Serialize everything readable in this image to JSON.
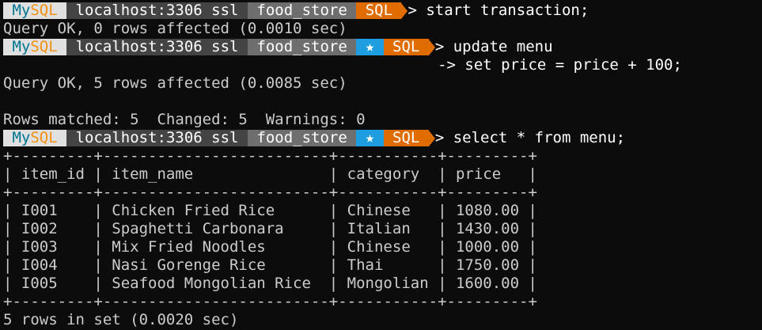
{
  "prompt": {
    "brand_my": "My",
    "brand_sql": "SQL",
    "host": "localhost:3306 ssl",
    "database": "food_store",
    "star": "★",
    "mode": "SQL",
    "arrow": "> ",
    "colors": {
      "mysql_bg": "#e0e0e0",
      "my_fg": "#00758f",
      "sql_fg": "#f29111",
      "host_bg": "#444444",
      "db_bg": "#6e6e6e",
      "star_bg": "#1e9ee0",
      "mode_bg": "#e06c00"
    }
  },
  "commands": {
    "c1": "start transaction;",
    "c2a": "update menu",
    "c2b": "                                                -> set price = price + 100;",
    "c3": "select * from menu;"
  },
  "outputs": {
    "o1": "Query OK, 0 rows affected (0.0010 sec)",
    "o2": "Query OK, 5 rows affected (0.0085 sec)",
    "o3": "Rows matched: 5  Changed: 5  Warnings: 0",
    "o4": "5 rows in set (0.0020 sec)"
  },
  "table": {
    "border": "+---------+-------------------------+-----------+---------+",
    "header": "| item_id | item_name               | category  | price   |",
    "rows": [
      "| I001    | Chicken Fried Rice      | Chinese   | 1080.00 |",
      "| I002    | Spaghetti Carbonara     | Italian   | 1430.00 |",
      "| I003    | Mix Fried Noodles       | Chinese   | 1000.00 |",
      "| I004    | Nasi Gorenge Rice       | Thai      | 1750.00 |",
      "| I005    | Seafood Mongolian Rice  | Mongolian | 1600.00 |"
    ]
  }
}
